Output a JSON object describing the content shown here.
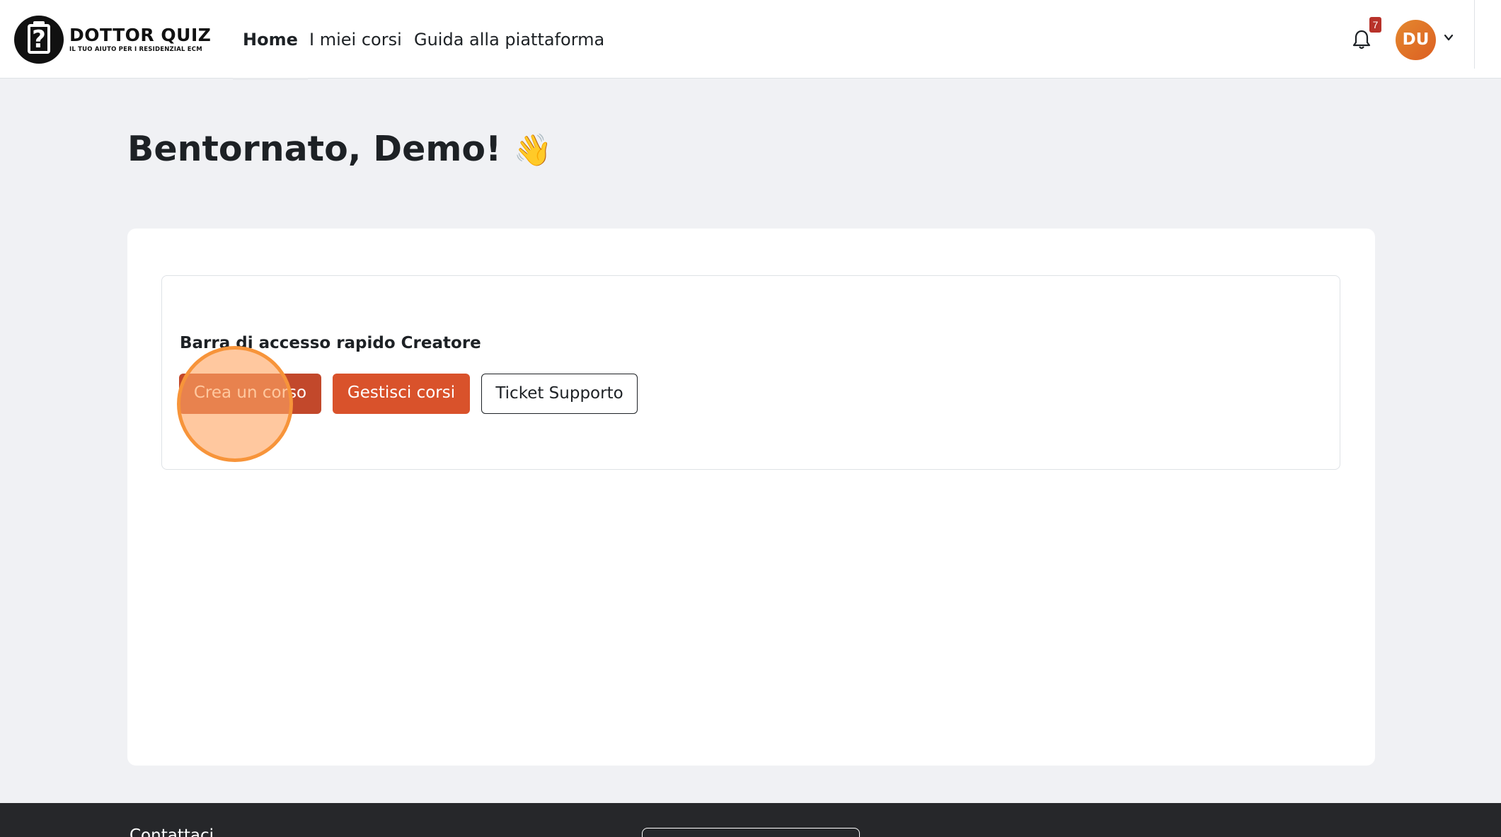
{
  "brand": {
    "name": "DOTTOR QUIZ",
    "tagline": "IL TUO AIUTO PER I RESIDENZIAL ECM",
    "logo_mark": "?"
  },
  "nav": {
    "items": [
      {
        "label": "Home",
        "active": true
      },
      {
        "label": "I miei corsi",
        "active": false
      },
      {
        "label": "Guida alla piattaforma",
        "active": false
      }
    ],
    "notification_count": "7",
    "user_initials": "DU",
    "icons": [
      "bell-icon",
      "chevron-down-icon"
    ]
  },
  "main": {
    "greeting": "Bentornato, Demo!",
    "greeting_emoji": "👋",
    "quick_bar": {
      "title": "Barra di accesso rapido Creatore",
      "buttons": [
        {
          "label": "Crea un corso"
        },
        {
          "label": "Gestisci corsi"
        },
        {
          "label": "Ticket Supporto"
        }
      ]
    }
  },
  "footer": {
    "title": "Contattaci"
  },
  "colors": {
    "primary_button": "#d9522b",
    "avatar": "#e4882e",
    "badge": "#b8322a",
    "page_bg": "#f0f1f4",
    "footer_bg": "#26272a",
    "click_highlight": "#f7943a"
  }
}
